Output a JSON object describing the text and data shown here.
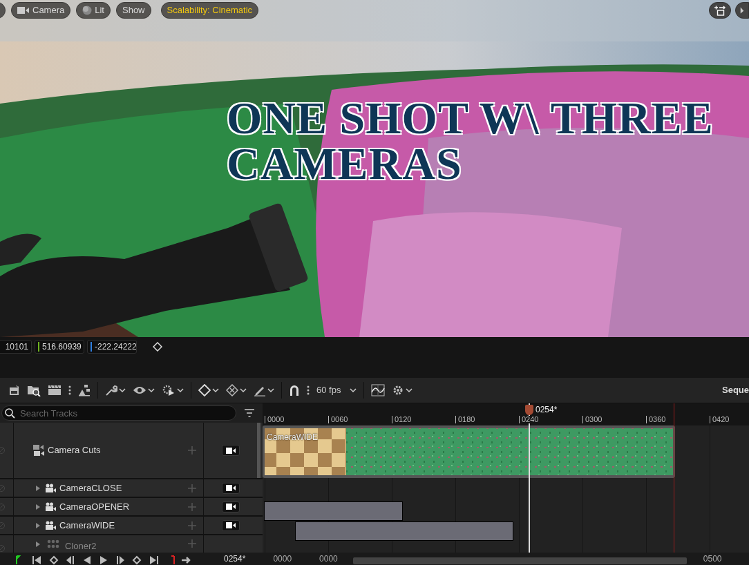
{
  "viewport": {
    "toolbar": [
      {
        "kind": "camera",
        "label": "Camera"
      },
      {
        "kind": "lit",
        "label": "Lit"
      },
      {
        "kind": "plain",
        "label": "Show"
      },
      {
        "kind": "scalability",
        "label": "Scalability: Cinematic"
      }
    ],
    "overlay_title": "ONE SHOT W\\ THREE CAMERAS"
  },
  "transform": {
    "fields": [
      {
        "value": "10101"
      },
      {
        "value": "516.60939",
        "color": "#6fb320"
      },
      {
        "value": "-222.24222",
        "color": "#2f7fe0"
      }
    ]
  },
  "sequencer_toolbar": {
    "fps": "60 fps",
    "title": "Seque"
  },
  "search": {
    "placeholder": "Search Tracks"
  },
  "tracks": [
    {
      "kind": "cuts",
      "label": "Camera Cuts"
    },
    {
      "kind": "camera",
      "label": "CameraCLOSE",
      "expanded": false
    },
    {
      "kind": "camera",
      "label": "CameraOPENER",
      "expanded": false
    },
    {
      "kind": "camera",
      "label": "CameraWIDE",
      "expanded": false
    },
    {
      "kind": "cloner",
      "label": "Cloner2",
      "expanded": false
    }
  ],
  "timeline": {
    "ruler": [
      "0000",
      "0060",
      "0120",
      "0180",
      "0240",
      "0300",
      "0360",
      "0420"
    ],
    "playhead": "0254*",
    "section": {
      "label": "CameraWIDE"
    }
  },
  "bottom_bar": {
    "current_frame": "0254*",
    "view_start": "0000",
    "range_start": "0000",
    "range_end": "0500"
  }
}
